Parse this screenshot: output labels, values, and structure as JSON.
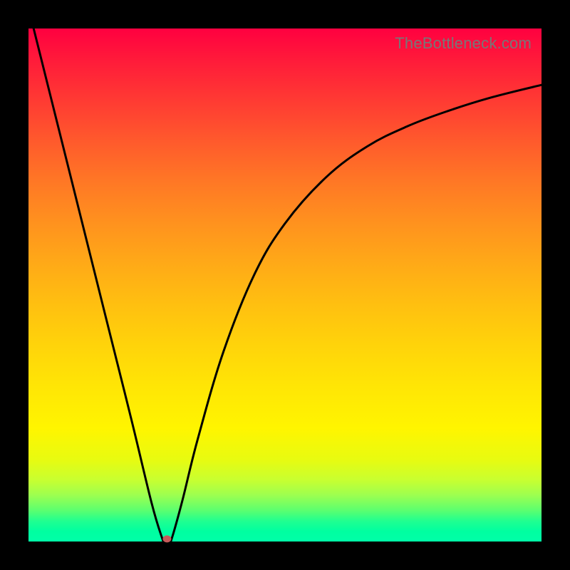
{
  "watermark": "TheBottleneck.com",
  "chart_data": {
    "type": "line",
    "title": "",
    "xlabel": "",
    "ylabel": "",
    "xlim": [
      0,
      100
    ],
    "ylim": [
      0,
      100
    ],
    "grid": false,
    "legend": false,
    "series": [
      {
        "name": "bottleneck-curve",
        "points": [
          {
            "x": 1,
            "y": 100
          },
          {
            "x": 5,
            "y": 84
          },
          {
            "x": 10,
            "y": 64
          },
          {
            "x": 15,
            "y": 44
          },
          {
            "x": 20,
            "y": 24
          },
          {
            "x": 24,
            "y": 7.5
          },
          {
            "x": 26,
            "y": 0.8
          },
          {
            "x": 26.5,
            "y": 0
          },
          {
            "x": 27.5,
            "y": 0
          },
          {
            "x": 28,
            "y": 0.8
          },
          {
            "x": 30,
            "y": 8
          },
          {
            "x": 33,
            "y": 20
          },
          {
            "x": 38,
            "y": 37
          },
          {
            "x": 44,
            "y": 52
          },
          {
            "x": 50,
            "y": 62
          },
          {
            "x": 58,
            "y": 71
          },
          {
            "x": 66,
            "y": 77
          },
          {
            "x": 74,
            "y": 81
          },
          {
            "x": 82,
            "y": 84
          },
          {
            "x": 90,
            "y": 86.5
          },
          {
            "x": 100,
            "y": 89
          }
        ]
      }
    ],
    "marker": {
      "x": 27,
      "y": 0.5,
      "rx": 6,
      "ry": 5
    },
    "background_gradient": {
      "direction": "top-to-bottom",
      "stops": [
        {
          "pos": 0,
          "color": "#ff0040"
        },
        {
          "pos": 20,
          "color": "#ff5a2c"
        },
        {
          "pos": 40,
          "color": "#ffaa17"
        },
        {
          "pos": 60,
          "color": "#ffd80a"
        },
        {
          "pos": 80,
          "color": "#fff500"
        },
        {
          "pos": 100,
          "color": "#00ffa8"
        }
      ]
    }
  }
}
